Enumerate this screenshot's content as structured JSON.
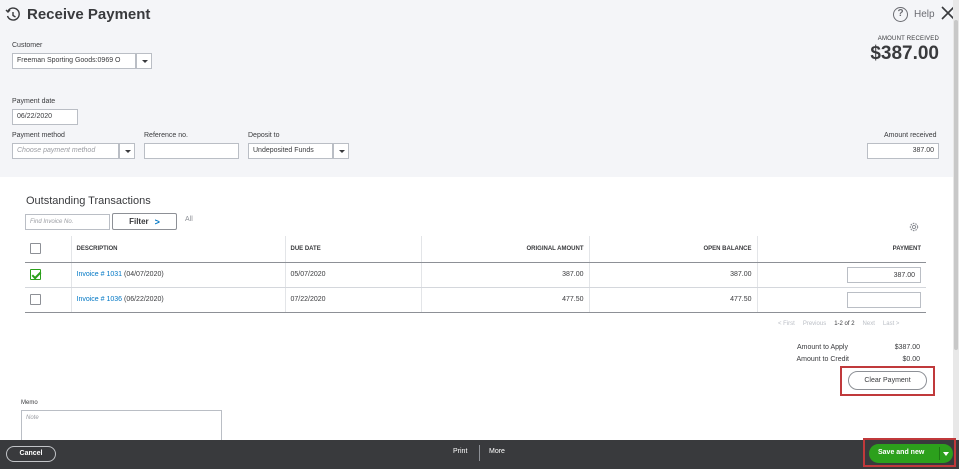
{
  "header": {
    "title": "Receive Payment",
    "help_label": "Help"
  },
  "form": {
    "customer_label": "Customer",
    "customer_value": "Freeman Sporting Goods:0969 O",
    "amount_received_caption": "AMOUNT RECEIVED",
    "amount_received_total": "$387.00",
    "payment_date_label": "Payment date",
    "payment_date_value": "06/22/2020",
    "payment_method_label": "Payment method",
    "payment_method_placeholder": "Choose payment method",
    "reference_label": "Reference no.",
    "reference_value": "",
    "deposit_to_label": "Deposit to",
    "deposit_to_value": "Undeposited Funds",
    "amount_received_label": "Amount received",
    "amount_received_value": "387.00"
  },
  "outstanding": {
    "title": "Outstanding Transactions",
    "find_placeholder": "Find Invoice No.",
    "filter_label": "Filter",
    "all_label": "All",
    "columns": [
      "DESCRIPTION",
      "DUE DATE",
      "ORIGINAL AMOUNT",
      "OPEN BALANCE",
      "PAYMENT"
    ],
    "rows": [
      {
        "checked": true,
        "invoice_link": "Invoice # 1031",
        "invoice_date": "(04/07/2020)",
        "due_date": "05/07/2020",
        "original_amount": "387.00",
        "open_balance": "387.00",
        "payment": "387.00"
      },
      {
        "checked": false,
        "invoice_link": "Invoice # 1036",
        "invoice_date": "(06/22/2020)",
        "due_date": "07/22/2020",
        "original_amount": "477.50",
        "open_balance": "477.50",
        "payment": ""
      }
    ],
    "pager": {
      "first": "< First",
      "previous": "Previous",
      "range": "1-2 of 2",
      "next": "Next",
      "last": "Last >"
    }
  },
  "summary": {
    "amount_to_apply_label": "Amount to Apply",
    "amount_to_apply_value": "$387.00",
    "amount_to_credit_label": "Amount to Credit",
    "amount_to_credit_value": "$0.00",
    "clear_payment_label": "Clear Payment"
  },
  "memo": {
    "label": "Memo",
    "placeholder": "Note"
  },
  "footer": {
    "cancel_label": "Cancel",
    "print_label": "Print",
    "more_label": "More",
    "save_label": "Save and new"
  },
  "colors": {
    "accent_green": "#2ca01c",
    "link_blue": "#0077c5",
    "highlight_red": "#c0393b",
    "footer_bg": "#393a3d"
  },
  "icons": [
    "history-icon",
    "help-icon",
    "close-icon",
    "gear-icon",
    "chevron-right-icon",
    "dropdown-arrow-icon"
  ]
}
